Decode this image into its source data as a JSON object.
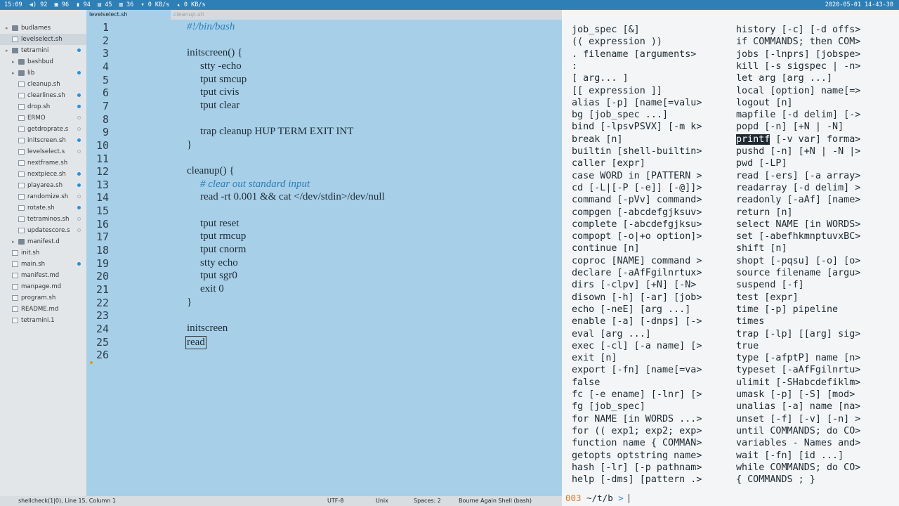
{
  "topbar": {
    "left": "15:09  ◀) 92  ▣ 96  ▮ 94  ▤ 45  ▥ 36  ▾ 0 KB/s  ▴ 0 KB/s",
    "right": "2020-05-01 14-43-30"
  },
  "sidebar": {
    "items": [
      {
        "label": "budlames",
        "kind": "folder",
        "depth": 0,
        "dot": ""
      },
      {
        "label": "levelselect.sh",
        "kind": "file",
        "depth": 1,
        "dot": "",
        "selected": true
      },
      {
        "label": "tetramini",
        "kind": "folder",
        "depth": 0,
        "dot": "blue"
      },
      {
        "label": "bashbud",
        "kind": "folder",
        "depth": 1,
        "dot": ""
      },
      {
        "label": "lib",
        "kind": "folder",
        "depth": 1,
        "dot": "blue"
      },
      {
        "label": "cleanup.sh",
        "kind": "file",
        "depth": 2,
        "dot": ""
      },
      {
        "label": "clearlines.sh",
        "kind": "file",
        "depth": 2,
        "dot": "blue"
      },
      {
        "label": "drop.sh",
        "kind": "file",
        "depth": 2,
        "dot": "blue"
      },
      {
        "label": "ERMO",
        "kind": "file",
        "depth": 2,
        "dot": "ring"
      },
      {
        "label": "getdroprate.s",
        "kind": "file",
        "depth": 2,
        "dot": "ring"
      },
      {
        "label": "initscreen.sh",
        "kind": "file",
        "depth": 2,
        "dot": "blue"
      },
      {
        "label": "levelselect.s",
        "kind": "file",
        "depth": 2,
        "dot": "ring"
      },
      {
        "label": "nextframe.sh",
        "kind": "file",
        "depth": 2,
        "dot": ""
      },
      {
        "label": "nextpiece.sh",
        "kind": "file",
        "depth": 2,
        "dot": "blue"
      },
      {
        "label": "playarea.sh",
        "kind": "file",
        "depth": 2,
        "dot": "blue"
      },
      {
        "label": "randomize.sh",
        "kind": "file",
        "depth": 2,
        "dot": "ring"
      },
      {
        "label": "rotate.sh",
        "kind": "file",
        "depth": 2,
        "dot": "blue"
      },
      {
        "label": "tetraminos.sh",
        "kind": "file",
        "depth": 2,
        "dot": "ring"
      },
      {
        "label": "updatescore.s",
        "kind": "file",
        "depth": 2,
        "dot": "ring"
      },
      {
        "label": "manifest.d",
        "kind": "folder",
        "depth": 1,
        "dot": ""
      },
      {
        "label": "init.sh",
        "kind": "file",
        "depth": 1,
        "dot": ""
      },
      {
        "label": "main.sh",
        "kind": "file",
        "depth": 1,
        "dot": "blue"
      },
      {
        "label": "manifest.md",
        "kind": "file",
        "depth": 1,
        "dot": ""
      },
      {
        "label": "manpage.md",
        "kind": "file",
        "depth": 1,
        "dot": ""
      },
      {
        "label": "program.sh",
        "kind": "file",
        "depth": 1,
        "dot": ""
      },
      {
        "label": "README.md",
        "kind": "file",
        "depth": 1,
        "dot": ""
      },
      {
        "label": "tetramini.1",
        "kind": "file",
        "depth": 1,
        "dot": ""
      }
    ]
  },
  "tabs": [
    {
      "label": "levelselect.sh",
      "active": true
    },
    {
      "label": "cleanup.sh",
      "active": false
    }
  ],
  "editor": {
    "lines": [
      {
        "n": "1",
        "text": "#!/bin/bash",
        "indent": 0,
        "comment": true
      },
      {
        "n": "2",
        "text": "",
        "indent": 0
      },
      {
        "n": "3",
        "text": "initscreen() {",
        "indent": 0
      },
      {
        "n": "4",
        "text": "stty -echo",
        "indent": 1
      },
      {
        "n": "5",
        "text": "tput smcup",
        "indent": 1
      },
      {
        "n": "6",
        "text": "tput civis",
        "indent": 1
      },
      {
        "n": "7",
        "text": "tput clear",
        "indent": 1
      },
      {
        "n": "8",
        "text": "",
        "indent": 0
      },
      {
        "n": "9",
        "text": "trap cleanup HUP TERM EXIT INT",
        "indent": 1
      },
      {
        "n": "10",
        "text": "}",
        "indent": 0
      },
      {
        "n": "11",
        "text": "",
        "indent": 0
      },
      {
        "n": "12",
        "text": "cleanup() {",
        "indent": 0
      },
      {
        "n": "13",
        "text": "# clear out standard input",
        "indent": 1,
        "comment": true
      },
      {
        "n": "14",
        "text": "read -rt 0.001 && cat </dev/stdin>/dev/null",
        "indent": 1
      },
      {
        "n": "15",
        "text": "",
        "indent": 0
      },
      {
        "n": "16",
        "text": "tput reset",
        "indent": 1
      },
      {
        "n": "17",
        "text": "tput rmcup",
        "indent": 1
      },
      {
        "n": "18",
        "text": "tput cnorm",
        "indent": 1
      },
      {
        "n": "19",
        "text": "stty echo",
        "indent": 1
      },
      {
        "n": "20",
        "text": "tput sgr0",
        "indent": 1
      },
      {
        "n": "21",
        "text": "exit 0",
        "indent": 1
      },
      {
        "n": "22",
        "text": "}",
        "indent": 0
      },
      {
        "n": "23",
        "text": "",
        "indent": 0
      },
      {
        "n": "24",
        "text": "initscreen",
        "indent": 0
      },
      {
        "n": "25",
        "text": "read",
        "indent": 0,
        "boxed": true
      },
      {
        "n": "26",
        "text": "",
        "indent": 0
      }
    ]
  },
  "statusbar": {
    "lint": "shellcheck(1|0), Line 15, Column 1",
    "encoding": "UTF-8",
    "line_endings": "Unix",
    "indent": "Spaces: 2",
    "syntax": "Bourne Again Shell (bash)"
  },
  "terminal": {
    "col1": [
      "job_spec [&]",
      "(( expression ))",
      ". filename [arguments>",
      ":",
      "[ arg... ]",
      "[[ expression ]]",
      "alias [-p] [name[=valu>",
      "bg [job_spec ...]",
      "bind [-lpsvPSVX] [-m k>",
      "break [n]",
      "builtin [shell-builtin>",
      "caller [expr]",
      "case WORD in [PATTERN >",
      "cd [-L|[-P [-e]] [-@]]>",
      "command [-pVv] command>",
      "compgen [-abcdefgjksuv>",
      "complete [-abcdefgjksu>",
      "compopt [-o|+o option]>",
      "continue [n]",
      "coproc [NAME] command >",
      "declare [-aAfFgilnrtux>",
      "dirs [-clpv] [+N] [-N>",
      "disown [-h] [-ar] [job>",
      "echo [-neE] [arg ...]",
      "enable [-a] [-dnps] [->",
      "eval [arg ...]",
      "exec [-cl] [-a name] [>",
      "exit [n]",
      "export [-fn] [name[=va>",
      "false",
      "fc [-e ename] [-lnr] [>",
      "fg [job_spec]",
      "for NAME [in WORDS ...>",
      "for (( exp1; exp2; exp>",
      "function name { COMMAN>",
      "getopts optstring name>",
      "hash [-lr] [-p pathnam>",
      "help [-dms] [pattern .>"
    ],
    "col2": [
      "history [-c] [-d offs>",
      "if COMMANDS; then COM>",
      "jobs [-lnprs] [jobspe>",
      "kill [-s sigspec | -n>",
      "let arg [arg ...]",
      "local [option] name[=>",
      "logout [n]",
      "mapfile [-d delim] [->",
      "popd [-n] [+N | -N]",
      "printf [-v var] forma>",
      "pushd [-n] [+N | -N |>",
      "pwd [-LP]",
      "read [-ers] [-a array>",
      "readarray [-d delim] >",
      "readonly [-aAf] [name>",
      "return [n]",
      "select NAME [in WORDS>",
      "set [-abefhkmnptuvxBC>",
      "shift [n]",
      "shopt [-pqsu] [-o] [o>",
      "source filename [argu>",
      "suspend [-f]",
      "test [expr]",
      "time [-p] pipeline",
      "times",
      "trap [-lp] [[arg] sig>",
      "true",
      "type [-afptP] name [n>",
      "typeset [-aAfFgilnrtu>",
      "ulimit [-SHabcdefiklm>",
      "umask [-p] [-S] [mod>",
      "unalias [-a] name [na>",
      "unset [-f] [-v] [-n] >",
      "until COMMANDS; do CO>",
      "variables - Names and>",
      "wait [-fn] [id ...]",
      "while COMMANDS; do CO>",
      "{ COMMANDS ; }"
    ],
    "highlight_word": "printf",
    "prompt": {
      "num": "003",
      "path": " ~/t/b ",
      "arrow": ">"
    }
  }
}
